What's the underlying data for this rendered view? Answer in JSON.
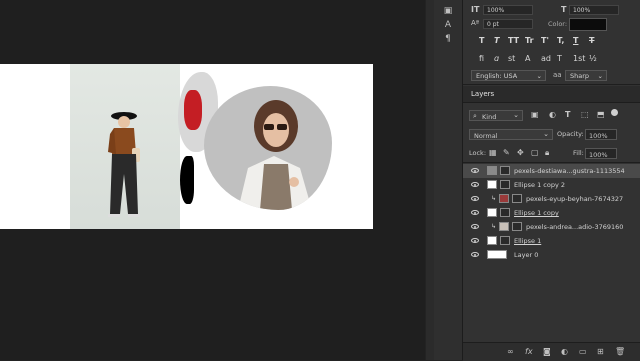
{
  "character": {
    "leading_value": "100%",
    "tracking_value": "100%",
    "baseline_value": "0 pt",
    "color_label": "Color:",
    "language": "English: USA",
    "antialias": "Sharp",
    "style_glyphs": [
      "T",
      "T",
      "TT",
      "Tr",
      "T'",
      "T,",
      "T",
      "T"
    ],
    "ot_glyphs": [
      "fi",
      "ɑ",
      "st",
      "A",
      "ad",
      "T",
      "1st",
      "½"
    ]
  },
  "layers": {
    "title": "Layers",
    "filter_kind": "Kind",
    "blend_mode": "Normal",
    "opacity_label": "Opacity:",
    "opacity_value": "100%",
    "lock_label": "Lock:",
    "fill_label": "Fill:",
    "fill_value": "100%",
    "items": [
      {
        "name": "pexels-destiawa...gustra-1113554",
        "clipped": false,
        "active": true
      },
      {
        "name": "Ellipse 1 copy 2",
        "clipped": false,
        "active": false
      },
      {
        "name": "pexels-eyup-beyhan-7674327",
        "clipped": true,
        "active": false
      },
      {
        "name": "Ellipse 1 copy",
        "clipped": false,
        "active": false
      },
      {
        "name": "pexels-andrea...adio-3769160",
        "clipped": true,
        "active": false
      },
      {
        "name": "Ellipse 1",
        "clipped": false,
        "active": false
      },
      {
        "name": "Layer 0",
        "clipped": false,
        "active": false
      }
    ]
  },
  "bottom_icons": [
    "link-icon",
    "fx-icon",
    "mask-icon",
    "adjustment-icon",
    "folder-icon",
    "new-layer-icon",
    "trash-icon"
  ],
  "colors": {
    "bg": "#232323",
    "panel": "#323232",
    "active_layer": "#4a4a4a",
    "red_outfit": "#c41e24"
  }
}
